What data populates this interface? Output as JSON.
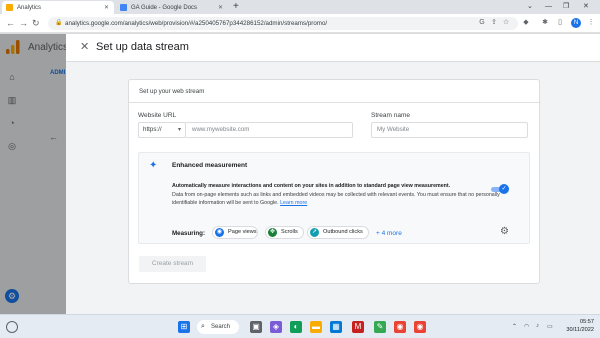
{
  "browser": {
    "tabs": [
      {
        "label": "Analytics",
        "active": true
      },
      {
        "label": "GA Guide - Google Docs",
        "active": false
      }
    ],
    "url": "analytics.google.com/analytics/web/provision/#/a250405767p344286152/admin/streams/promo/"
  },
  "profile": {
    "initial": "N"
  },
  "app": {
    "name": "Analytics",
    "admin_tab": "ADMI"
  },
  "panel": {
    "title": "Set up data stream",
    "card_subtitle": "Set up your web stream",
    "website_url_label": "Website URL",
    "protocol_value": "https://",
    "url_placeholder": "www.mywebsite.com",
    "stream_name_label": "Stream name",
    "stream_name_placeholder": "My Website",
    "enhanced": {
      "title": "Enhanced measurement",
      "bold_text": "Automatically measure interactions and content on your sites in addition to standard page view measurement.",
      "desc": "Data from on-page elements such as links and embedded videos may be collected with relevant events. You must ensure that no personally identifiable information will be sent to Google.",
      "learn_more": "Learn more",
      "toggle_on": true,
      "measuring_label": "Measuring:",
      "chips": [
        {
          "label": "Page views",
          "icon": "eye-icon",
          "color": "#1a73e8"
        },
        {
          "label": "Scrolls",
          "icon": "scroll-icon",
          "color": "#188038"
        },
        {
          "label": "Outbound clicks",
          "icon": "cursor-icon",
          "color": "#129eaf"
        }
      ],
      "more_label": "+ 4 more"
    },
    "create_button": "Create stream"
  },
  "taskbar": {
    "search_label": "Search",
    "time": "05:57",
    "date": "30/11/2022"
  }
}
